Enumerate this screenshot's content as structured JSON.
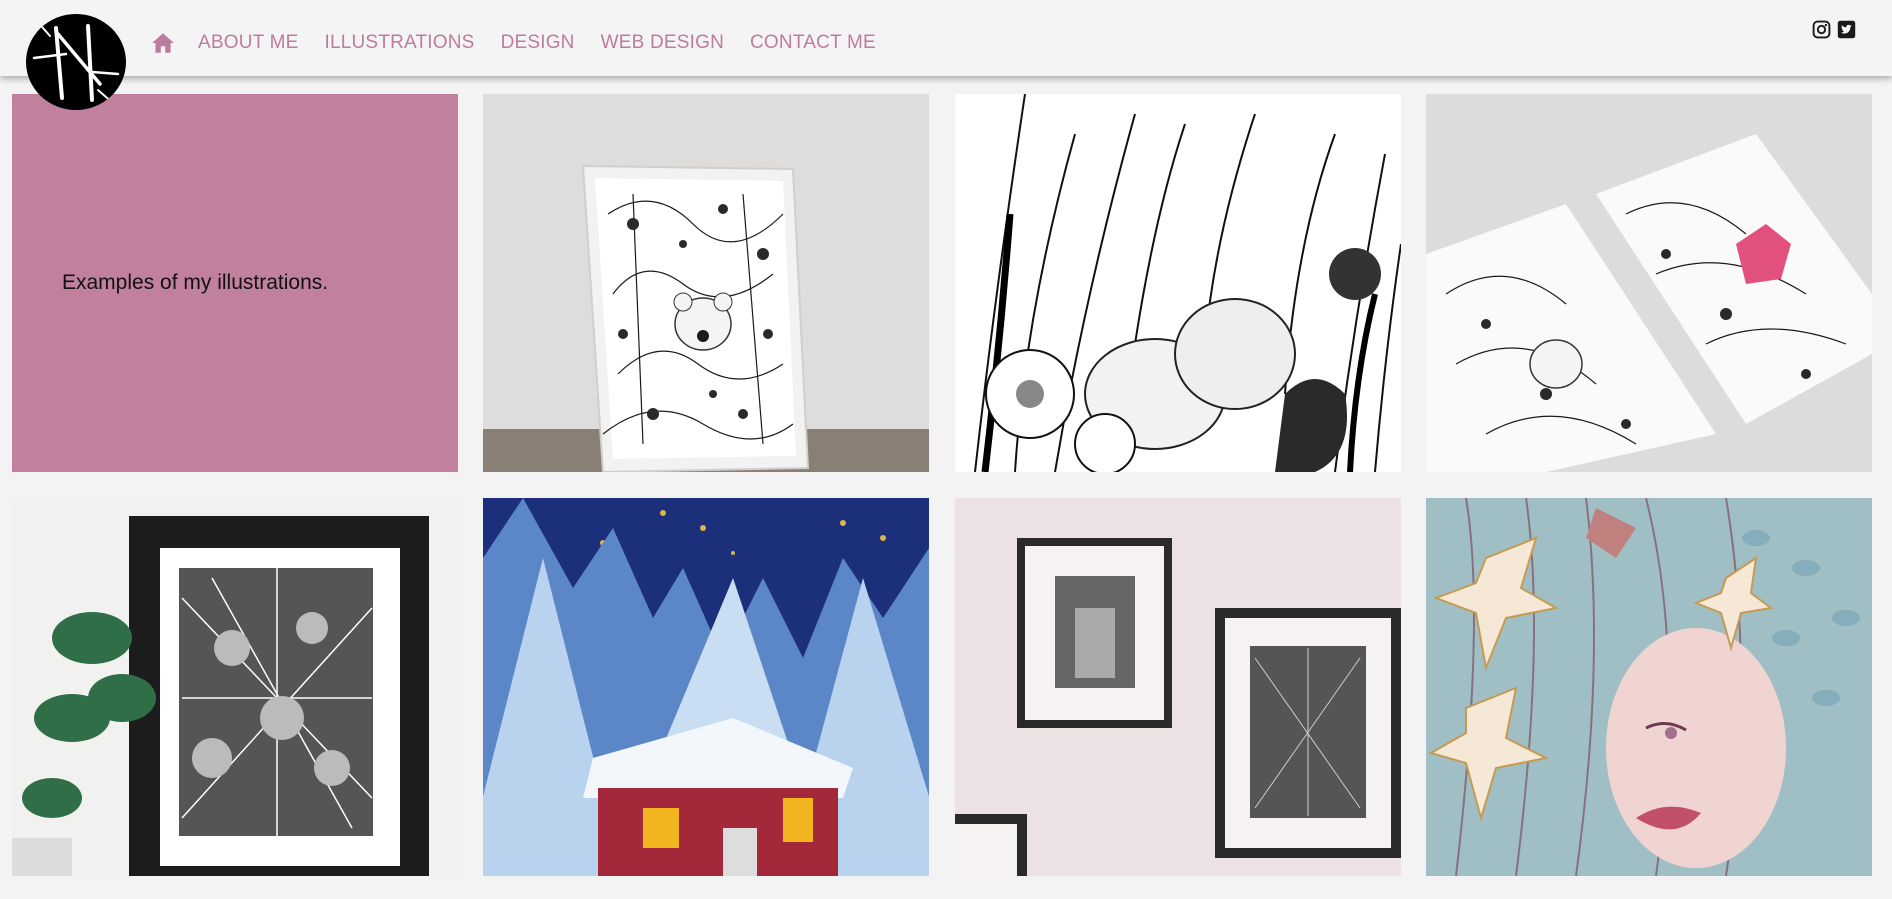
{
  "nav": {
    "home_icon": "home-icon",
    "items": [
      "ABOUT ME",
      "ILLUSTRATIONS",
      "DESIGN",
      "WEB DESIGN",
      "CONTACT ME"
    ]
  },
  "social": {
    "icons": [
      "instagram-icon",
      "twitter-icon"
    ]
  },
  "intro": {
    "caption": "Examples of my illustrations."
  },
  "gallery": {
    "items": [
      "framed-mouse-illustration",
      "hedgehogs-in-flowers-illustration",
      "two-prints-illustration",
      "framed-leaves-illustration-with-plant",
      "winter-cabin-watercolor",
      "framed-prints-on-pink-wall",
      "watercolor-face-with-lilies"
    ]
  },
  "colors": {
    "accent": "#bd7c9d",
    "intro_bg": "#c0809e",
    "header_bg": "#f5f4f4",
    "page_bg": "#f4f3f3"
  }
}
